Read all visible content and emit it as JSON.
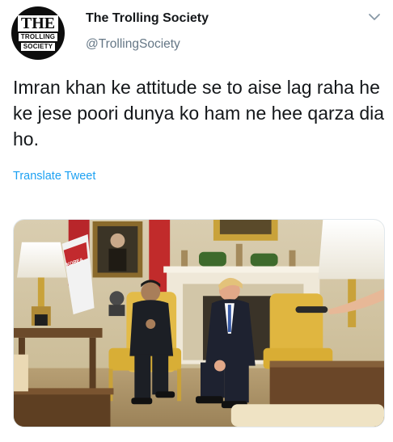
{
  "account": {
    "display_name": "The Trolling Society",
    "handle": "@TrollingSociety",
    "avatar_text": [
      "THE",
      "TROLLING",
      "SOCIETY"
    ]
  },
  "tweet": {
    "text": "Imran khan ke attitude se to aise lag raha he ke jese poori dunya ko ham ne hee qarza dia ho.",
    "translate_label": "Translate Tweet"
  },
  "media": {
    "kind": "photo",
    "flag_text": "KOREA"
  },
  "icons": {
    "menu": "chevron-down-icon"
  },
  "colors": {
    "link": "#1da1f2",
    "secondary_text": "#657786",
    "primary_text": "#14171a"
  }
}
